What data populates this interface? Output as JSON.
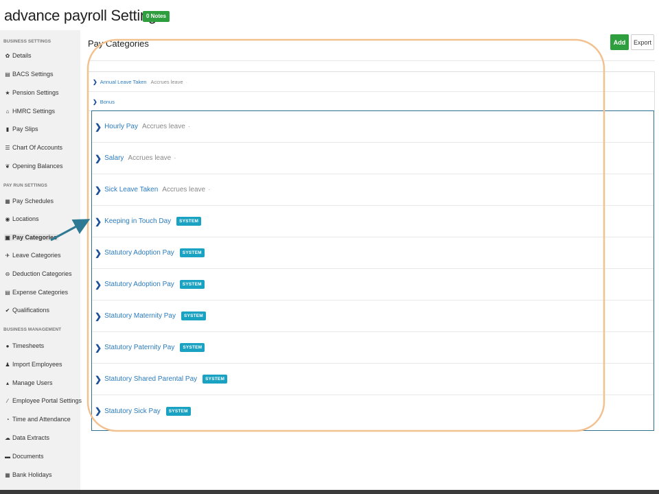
{
  "page": {
    "title": "advance payroll Settings",
    "notes_badge": "0 Notes"
  },
  "sidebar": {
    "sections": [
      {
        "label": "BUSINESS SETTINGS"
      },
      {
        "label": "PAY RUN SETTINGS"
      },
      {
        "label": "BUSINESS MANAGEMENT"
      }
    ],
    "items": [
      {
        "label": "Details",
        "icon": "gear-icon"
      },
      {
        "label": "BACS Settings",
        "icon": "document-icon"
      },
      {
        "label": "Pension Settings",
        "icon": "star-icon"
      },
      {
        "label": "HMRC Settings",
        "icon": "bank-icon"
      },
      {
        "label": "Pay Slips",
        "icon": "file-icon"
      },
      {
        "label": "Chart Of Accounts",
        "icon": "list-icon"
      },
      {
        "label": "Opening Balances",
        "icon": "leaf-icon"
      },
      {
        "label": "Pay Schedules",
        "icon": "calendar-icon"
      },
      {
        "label": "Locations",
        "icon": "map-marker-icon"
      },
      {
        "label": "Pay Categories",
        "icon": "money-icon",
        "active": true
      },
      {
        "label": "Leave Categories",
        "icon": "plane-icon"
      },
      {
        "label": "Deduction Categories",
        "icon": "minus-circle-icon"
      },
      {
        "label": "Expense Categories",
        "icon": "receipt-icon"
      },
      {
        "label": "Qualifications",
        "icon": "check-icon"
      },
      {
        "label": "Timesheets",
        "icon": "clock-icon"
      },
      {
        "label": "Import Employees",
        "icon": "users-icon"
      },
      {
        "label": "Manage Users",
        "icon": "lock-icon"
      },
      {
        "label": "Employee Portal Settings",
        "icon": "wand-icon"
      },
      {
        "label": "Time and Attendance",
        "icon": "timer-icon"
      },
      {
        "label": "Data Extracts",
        "icon": "cloud-icon"
      },
      {
        "label": "Documents",
        "icon": "folder-icon"
      },
      {
        "label": "Bank Holidays",
        "icon": "calendar-icon"
      }
    ]
  },
  "main": {
    "title": "Pay Categories",
    "add_label": "Add",
    "export_label": "Export",
    "top_rows": [
      {
        "name": "Annual Leave Taken",
        "meta": "Accrues leave",
        "dot": "·"
      },
      {
        "name": "Bonus"
      }
    ],
    "rows": [
      {
        "name": "Hourly Pay",
        "meta": "Accrues leave",
        "dot": "·"
      },
      {
        "name": "Salary",
        "meta": "Accrues leave",
        "dot": "·"
      },
      {
        "name": "Sick Leave Taken",
        "meta": "Accrues leave",
        "dot": "·"
      },
      {
        "name": "Keeping in Touch Day",
        "badge": "SYSTEM"
      },
      {
        "name": "Statutory Adoption Pay",
        "badge": "SYSTEM"
      },
      {
        "name": "Statutory Adoption Pay",
        "badge": "SYSTEM"
      },
      {
        "name": "Statutory Maternity Pay",
        "badge": "SYSTEM"
      },
      {
        "name": "Statutory Paternity Pay",
        "badge": "SYSTEM"
      },
      {
        "name": "Statutory Shared Parental Pay",
        "badge": "SYSTEM"
      },
      {
        "name": "Statutory Sick Pay",
        "badge": "SYSTEM"
      }
    ]
  },
  "colors": {
    "accent_green": "#2e9e3e",
    "link_blue": "#2a7bbf",
    "system_badge": "#1aa2c2",
    "annotation_orange": "#f3c190",
    "annotation_arrow": "#2e7a94"
  }
}
